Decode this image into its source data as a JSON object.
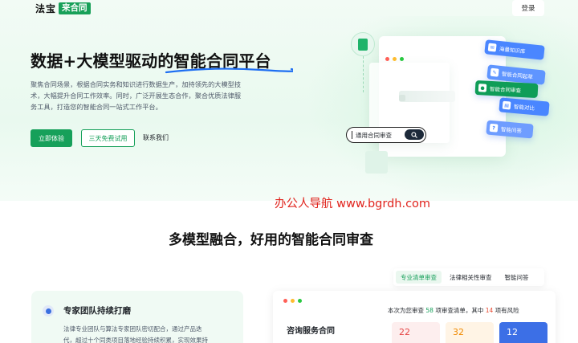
{
  "header": {
    "logo_text": "法宝",
    "logo_badge": "来合同",
    "login_label": "登录"
  },
  "hero": {
    "title": "数据+大模型驱动的智能合同平台",
    "description_lines": [
      "聚焦合同场景，根据合同实务和知识进行数据生产，加持领先的大模型技",
      "术，大幅提升合同工作效率。同时，广泛开展生态合作，聚合优质法律服",
      "务工具，打造您的智能合同一站式工作平台。"
    ],
    "primary_button": "立即体验",
    "trial_button": "三天免费试用",
    "contact_link": "联系我们"
  },
  "illustration": {
    "pills": [
      {
        "label": "海量知识库",
        "color": "#4a86ff"
      },
      {
        "label": "智能合同起草",
        "color": "#4a86ff"
      },
      {
        "label": "智能合同审查",
        "color": "#0f9d58"
      },
      {
        "label": "智能对比",
        "color": "#4a86ff"
      },
      {
        "label": "智能问答",
        "color": "#4a86ff"
      }
    ],
    "search_text": "通用合同审查"
  },
  "watermark": "办公人导航 www.bgrdh.com",
  "section": {
    "title": "多模型融合，好用的智能合同审查"
  },
  "tabs": [
    {
      "label": "专业清单审查",
      "active": true
    },
    {
      "label": "法律相关性审查",
      "active": false
    },
    {
      "label": "智能问答",
      "active": false
    }
  ],
  "feature": {
    "title": "专家团队持续打磨",
    "description_lines": [
      "法律专业团队与算法专家团队密切配合，通过产品迭",
      "代，超过十个同类项目落地经验持续积累，实现效果持"
    ]
  },
  "preview": {
    "contract_title": "咨询服务合同",
    "summary_prefix": "本次为您审查",
    "summary_count": "58",
    "summary_middle": "项审查清单，其中",
    "summary_risk": "14",
    "summary_suffix": "项有风险",
    "stats": [
      "22",
      "32",
      "12"
    ]
  },
  "colors": {
    "brand_green": "#16a05a",
    "accent_blue": "#4a86ff",
    "watermark_red": "#e0231c"
  }
}
